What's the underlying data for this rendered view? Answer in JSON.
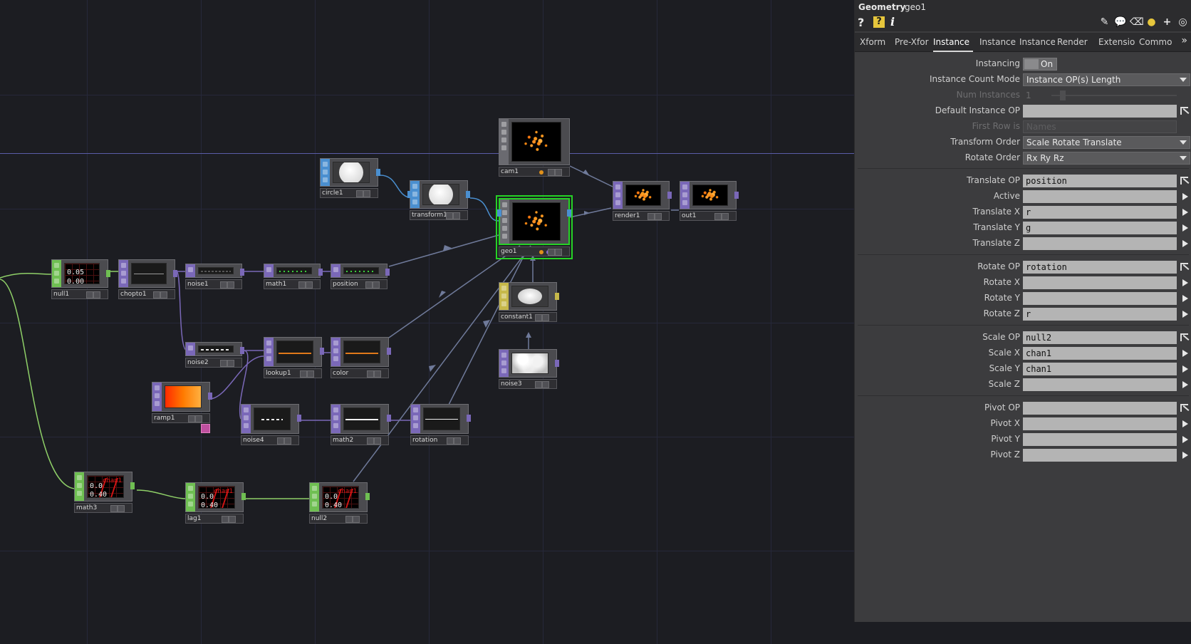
{
  "network": {
    "nodes": [
      {
        "id": "cam1",
        "label": "cam1"
      },
      {
        "id": "circle1",
        "label": "circle1"
      },
      {
        "id": "transform1",
        "label": "transform1"
      },
      {
        "id": "geo1",
        "label": "geo1"
      },
      {
        "id": "render1",
        "label": "render1"
      },
      {
        "id": "out1",
        "label": "out1"
      },
      {
        "id": "null1",
        "label": "null1",
        "values": [
          "0.05",
          "0.00"
        ]
      },
      {
        "id": "chopto1",
        "label": "chopto1"
      },
      {
        "id": "noise1",
        "label": "noise1"
      },
      {
        "id": "math1",
        "label": "math1"
      },
      {
        "id": "position",
        "label": "position"
      },
      {
        "id": "constant1",
        "label": "constant1"
      },
      {
        "id": "noise2",
        "label": "noise2"
      },
      {
        "id": "lookup1",
        "label": "lookup1"
      },
      {
        "id": "color",
        "label": "color"
      },
      {
        "id": "noise3",
        "label": "noise3"
      },
      {
        "id": "ramp1",
        "label": "ramp1"
      },
      {
        "id": "noise4",
        "label": "noise4"
      },
      {
        "id": "math2",
        "label": "math2"
      },
      {
        "id": "rotation",
        "label": "rotation"
      },
      {
        "id": "math3",
        "label": "math3",
        "values": [
          "0.0",
          "0.40"
        ],
        "chan": "chan1"
      },
      {
        "id": "lag1",
        "label": "lag1",
        "values": [
          "0.0",
          "0.40"
        ],
        "chan": "chan1"
      },
      {
        "id": "null2",
        "label": "null2",
        "values": [
          "0.0",
          "0.40"
        ],
        "chan": "chan1"
      }
    ]
  },
  "panel": {
    "op_type": "Geometry",
    "op_name": "geo1",
    "toolbar": {
      "help_icon": "question-icon",
      "op_help_icon": "op-help-icon",
      "info_icon": "info-icon",
      "right_icons": [
        "pencil-icon",
        "comment-icon",
        "eraser-icon",
        "python-icon",
        "plus-icon",
        "target-icon"
      ]
    },
    "tabs": [
      {
        "label": "Xform"
      },
      {
        "label": "Pre-Xfor"
      },
      {
        "label": "Instance",
        "active": true
      },
      {
        "label": "Instance"
      },
      {
        "label": "Instance"
      },
      {
        "label": "Render"
      },
      {
        "label": "Extensio"
      },
      {
        "label": "Commo"
      }
    ],
    "tab_more": "»",
    "params": {
      "instancing": {
        "label": "Instancing",
        "value": "On"
      },
      "instance_count_mode": {
        "label": "Instance Count Mode",
        "value": "Instance OP(s) Length"
      },
      "num_instances": {
        "label": "Num Instances",
        "value": "1"
      },
      "default_instance_op": {
        "label": "Default Instance OP",
        "value": ""
      },
      "first_row_is": {
        "label": "First Row is",
        "value": "Names"
      },
      "transform_order": {
        "label": "Transform Order",
        "value": "Scale Rotate Translate"
      },
      "rotate_order": {
        "label": "Rotate Order",
        "value": "Rx Ry Rz"
      },
      "translate_op": {
        "label": "Translate OP",
        "value": "position"
      },
      "active": {
        "label": "Active",
        "value": ""
      },
      "translate_x": {
        "label": "Translate X",
        "value": "r"
      },
      "translate_y": {
        "label": "Translate Y",
        "value": "g"
      },
      "translate_z": {
        "label": "Translate Z",
        "value": ""
      },
      "rotate_op": {
        "label": "Rotate OP",
        "value": "rotation"
      },
      "rotate_x": {
        "label": "Rotate X",
        "value": ""
      },
      "rotate_y": {
        "label": "Rotate Y",
        "value": ""
      },
      "rotate_z": {
        "label": "Rotate Z",
        "value": "r"
      },
      "scale_op": {
        "label": "Scale OP",
        "value": "null2"
      },
      "scale_x": {
        "label": "Scale X",
        "value": "chan1"
      },
      "scale_y": {
        "label": "Scale Y",
        "value": "chan1"
      },
      "scale_z": {
        "label": "Scale Z",
        "value": ""
      },
      "pivot_op": {
        "label": "Pivot OP",
        "value": ""
      },
      "pivot_x": {
        "label": "Pivot X",
        "value": ""
      },
      "pivot_y": {
        "label": "Pivot Y",
        "value": ""
      },
      "pivot_z": {
        "label": "Pivot Z",
        "value": ""
      }
    }
  }
}
